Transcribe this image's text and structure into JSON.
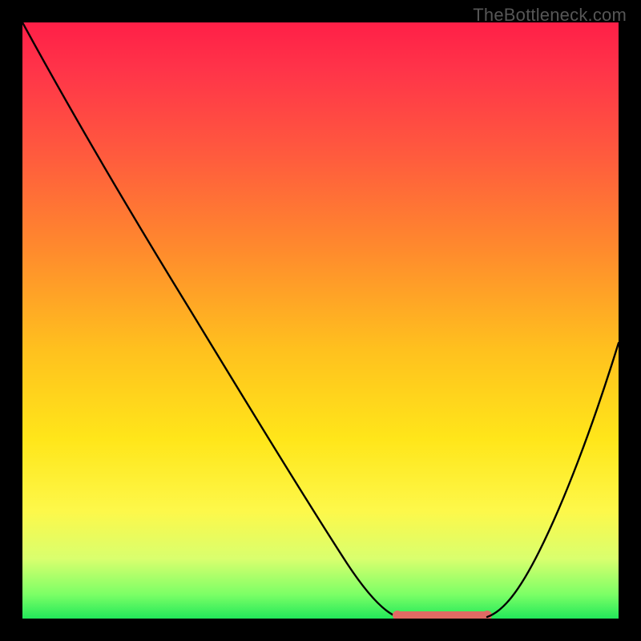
{
  "watermark": {
    "text": "TheBottleneck.com"
  },
  "chart_data": {
    "type": "line",
    "title": "",
    "xlabel": "",
    "ylabel": "",
    "xlim": [
      0,
      100
    ],
    "ylim": [
      0,
      100
    ],
    "grid": false,
    "legend": false,
    "background_gradient": {
      "direction": "vertical",
      "stops": [
        {
          "pos": 0.0,
          "color": "#ff1f47"
        },
        {
          "pos": 0.55,
          "color": "#ffc11e"
        },
        {
          "pos": 0.82,
          "color": "#fdf84a"
        },
        {
          "pos": 1.0,
          "color": "#22e85a"
        }
      ]
    },
    "series": [
      {
        "name": "left-curve",
        "x": [
          0,
          10,
          20,
          30,
          40,
          50,
          58,
          62
        ],
        "values": [
          100,
          84,
          68,
          52,
          36,
          20,
          6,
          0
        ]
      },
      {
        "name": "right-curve",
        "x": [
          78,
          82,
          88,
          94,
          100
        ],
        "values": [
          0,
          7,
          20,
          34,
          48
        ]
      },
      {
        "name": "flat-optimal-region",
        "x": [
          62,
          78
        ],
        "values": [
          0,
          0
        ],
        "color": "#e16a64"
      }
    ],
    "annotations": []
  }
}
